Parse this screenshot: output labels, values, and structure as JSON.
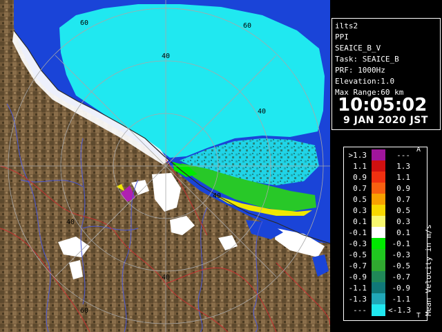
{
  "radar": {
    "range_labels": [
      "60",
      "60",
      "40",
      "40",
      "40",
      "40",
      "40",
      "60"
    ]
  },
  "info": {
    "site": "ilts2",
    "mode": "PPI",
    "product": "SEAICE_B_V",
    "task": "Task: SEAICE_B",
    "prf": "PRF: 1000Hz",
    "elevation": "Elevation:1.0",
    "max_range": "Max Range:60 km",
    "time": "10:05:02",
    "date": "9 JAN 2020 JST"
  },
  "legend": {
    "unit_label": "Mean Velocity in m/s",
    "top_marker": "A",
    "bottom_marker": "T",
    "rows": [
      {
        "left": ">1.3",
        "right": "---",
        "color": "#a0159c"
      },
      {
        "left": "1.1",
        "right": "1.3",
        "color": "#d01010"
      },
      {
        "left": "0.9",
        "right": "1.1",
        "color": "#f03010"
      },
      {
        "left": "0.7",
        "right": "0.9",
        "color": "#f86010"
      },
      {
        "left": "0.5",
        "right": "0.7",
        "color": "#f8a000"
      },
      {
        "left": "0.3",
        "right": "0.5",
        "color": "#f8d800"
      },
      {
        "left": "0.1",
        "right": "0.3",
        "color": "#f8f870"
      },
      {
        "left": "-0.1",
        "right": "0.1",
        "color": "#ffffff"
      },
      {
        "left": "-0.3",
        "right": "-0.1",
        "color": "#00e800"
      },
      {
        "left": "-0.5",
        "right": "-0.3",
        "color": "#20c820"
      },
      {
        "left": "-0.7",
        "right": "-0.5",
        "color": "#30a830"
      },
      {
        "left": "-0.9",
        "right": "-0.7",
        "color": "#208858"
      },
      {
        "left": "-1.1",
        "right": "-0.9",
        "color": "#107878"
      },
      {
        "left": "-1.3",
        "right": "-1.1",
        "color": "#20a8b8"
      },
      {
        "left": "---",
        "right": "<-1.3",
        "color": "#20e8f0"
      }
    ]
  }
}
